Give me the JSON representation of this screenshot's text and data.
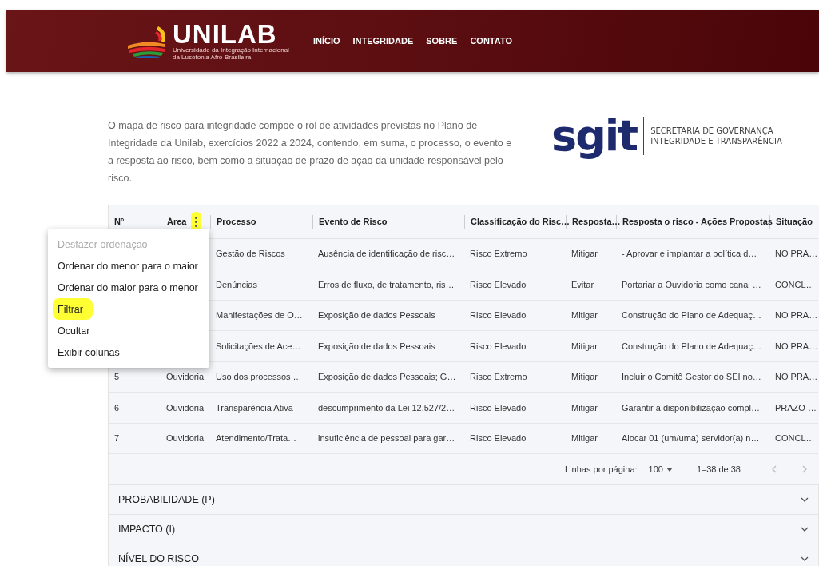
{
  "header": {
    "logo": {
      "name": "UNILAB",
      "subtitle_lines": [
        "Universidade da Integração Internacional",
        "da Lusofonia Afro-Brasileira"
      ]
    },
    "nav": [
      {
        "label": "INÍCIO"
      },
      {
        "label": "INTEGRIDADE"
      },
      {
        "label": "SOBRE"
      },
      {
        "label": "CONTATO"
      }
    ]
  },
  "intro": "O mapa de risco para integridade compõe o rol de atividades previstas no Plano de Integridade da Unilab, exercícios 2022 a 2024, contendo, em suma, o processo, o evento e a resposta ao risco, bem como a situação de prazo de ação da unidade responsável pelo risco.",
  "sgit_logo": {
    "mark": "sgit",
    "lines": [
      "SECRETARIA DE GOVERNANÇA",
      "INTEGRIDADE E TRANSPARÊNCIA"
    ]
  },
  "table": {
    "columns": [
      {
        "label": "N°"
      },
      {
        "label": "Área",
        "menu_icon": {
          "highlighted": true
        }
      },
      {
        "label": "Processo"
      },
      {
        "label": "Evento de Risco"
      },
      {
        "label": "Classificação do Risc…"
      },
      {
        "label": "Resposta…"
      },
      {
        "label": "Resposta o risco - Ações Propostas"
      },
      {
        "label": "Situação"
      }
    ],
    "rows": [
      {
        "cells": [
          null,
          null,
          "Gestão de Riscos",
          "Ausência de identificação de risc…",
          "Risco Extremo",
          "Mitigar",
          "- Aprovar e implantar a política d…",
          "NO PRA…"
        ]
      },
      {
        "cells": [
          null,
          null,
          "Denúncias",
          "Erros de fluxo, de tratamento, ris…",
          "Risco Elevado",
          "Evitar",
          "Portariar a Ouvidoria como canal …",
          "CONCL…"
        ]
      },
      {
        "cells": [
          null,
          null,
          "Manifestações de O…",
          "Exposição de dados Pessoais",
          "Risco Elevado",
          "Mitigar",
          "Construção do Plano de Adequaç…",
          "NO PRA…"
        ]
      },
      {
        "cells": [
          null,
          null,
          "Solicitações de Ace…",
          "Exposição de dados Pessoais",
          "Risco Elevado",
          "Mitigar",
          "Construção do Plano de Adequaç…",
          "NO PRA…"
        ]
      },
      {
        "cells": [
          "5",
          "Ouvidoria",
          "Uso dos processos …",
          "Exposição de dados Pessoais; G…",
          "Risco Extremo",
          "Mitigar",
          "Incluir o Comitê Gestor do SEI no…",
          "NO PRA…"
        ]
      },
      {
        "cells": [
          "6",
          "Ouvidoria",
          "Transparência Ativa",
          "descumprimento da Lei 12.527/2…",
          "Risco Elevado",
          "Mitigar",
          "Garantir a disponibilização compl…",
          "PRAZO …"
        ]
      },
      {
        "cells": [
          "7",
          "Ouvidoria",
          "Atendimento/Trata…",
          "insuficiência de pessoal para gar…",
          "Risco Elevado",
          "Mitigar",
          "Alocar 01 (um/uma) servidor(a) n…",
          "CONCL…"
        ]
      }
    ],
    "footer": {
      "rows_label": "Linhas por página:",
      "rows_value": "100",
      "range": "1–38 de 38",
      "prev_disabled": true,
      "next_disabled": true
    }
  },
  "column_menu": [
    {
      "label": "Desfazer ordenação",
      "disabled": true,
      "highlighted": false
    },
    {
      "label": "Ordenar do menor para o maior",
      "disabled": false,
      "highlighted": false
    },
    {
      "label": "Ordenar do maior para o menor",
      "disabled": false,
      "highlighted": false
    },
    {
      "label": "Filtrar",
      "disabled": false,
      "highlighted": true
    },
    {
      "label": "Ocultar",
      "disabled": false,
      "highlighted": false
    },
    {
      "label": "Exibir colunas",
      "disabled": false,
      "highlighted": false
    }
  ],
  "accordions": [
    {
      "title": "PROBABILIDADE (P)",
      "expanded": false
    },
    {
      "title": "IMPACTO (I)",
      "expanded": false
    },
    {
      "title": "NÍVEL DO RISCO",
      "expanded": false
    }
  ]
}
